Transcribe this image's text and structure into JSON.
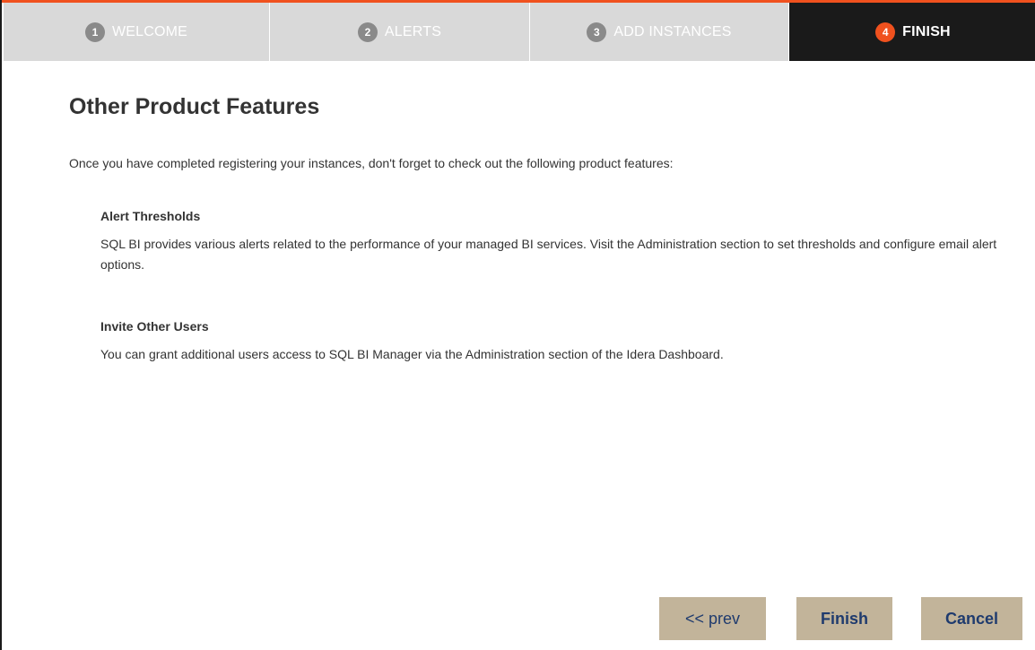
{
  "wizard": {
    "steps": [
      {
        "number": "1",
        "label": "WELCOME"
      },
      {
        "number": "2",
        "label": "ALERTS"
      },
      {
        "number": "3",
        "label": "ADD INSTANCES"
      },
      {
        "number": "4",
        "label": "FINISH"
      }
    ],
    "active_step": 4
  },
  "colors": {
    "accent": "#f0511e",
    "active_step_bg": "#1a1a1a",
    "inactive_step_bg": "#d9d9d9",
    "button_bg": "#c2b49a",
    "button_text": "#1f3b6e"
  },
  "main": {
    "title": "Other Product Features",
    "intro": "Once you have completed registering your instances, don't forget to check out the following product features:",
    "features": [
      {
        "title": "Alert Thresholds",
        "description": "SQL BI provides various alerts related to the performance of your managed BI services. Visit the Administration section to set thresholds and configure email alert options."
      },
      {
        "title": "Invite Other Users",
        "description": "You can grant additional users access to SQL BI Manager via the Administration section of the Idera Dashboard."
      }
    ]
  },
  "footer": {
    "prev_label": "<< prev",
    "finish_label": "Finish",
    "cancel_label": "Cancel"
  }
}
